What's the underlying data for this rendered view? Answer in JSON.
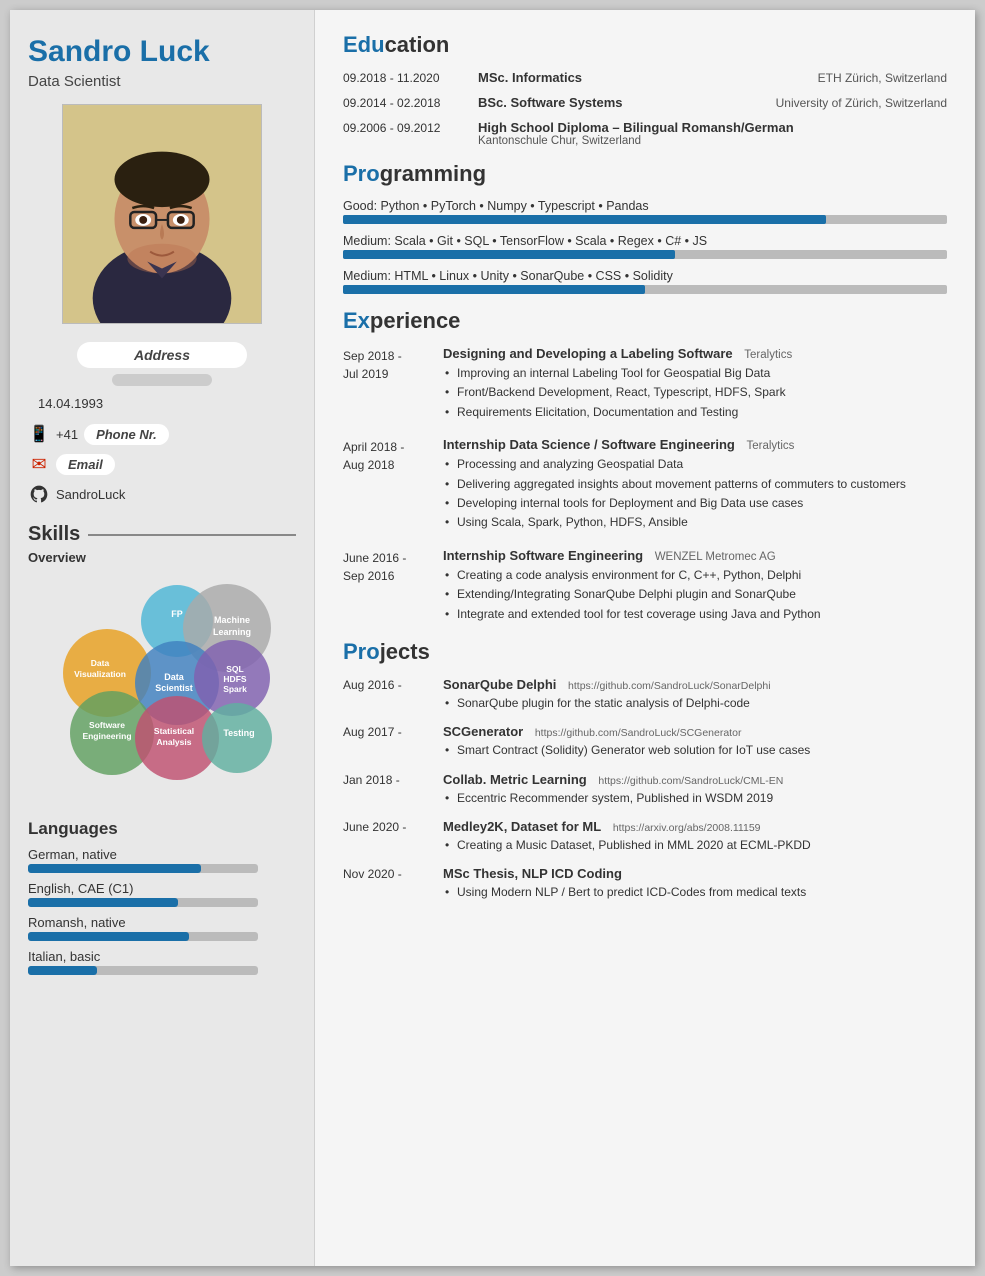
{
  "left": {
    "name": "Sandro Luck",
    "title": "Data Scientist",
    "address_label": "Address",
    "dob": "14.04.1993",
    "phone_prefix": "+41",
    "phone_label": "Phone Nr.",
    "email_label": "Email",
    "github": "SandroLuck",
    "skills_title": "Skills",
    "overview_label": "Overview",
    "venn_circles": [
      {
        "label": "FP",
        "class": "vc-fp"
      },
      {
        "label": "Machine\nLearning",
        "class": "vc-ml"
      },
      {
        "label": "Data\nVisualization",
        "class": "vc-dv"
      },
      {
        "label": "Data\nScientist",
        "class": "vc-ds"
      },
      {
        "label": "SQL\nHDFS\nSpark",
        "class": "vc-sql"
      },
      {
        "label": "Software\nEngineering",
        "class": "vc-se"
      },
      {
        "label": "Statistical\nAnalysis",
        "class": "vc-sa"
      },
      {
        "label": "Testing",
        "class": "vc-test"
      }
    ],
    "languages_title": "Languages",
    "languages": [
      {
        "name": "German, native",
        "fill_pct": 75
      },
      {
        "name": "English, CAE (C1)",
        "fill_pct": 65
      },
      {
        "name": "Romansh, native",
        "fill_pct": 70
      },
      {
        "name": "Italian, basic",
        "fill_pct": 30
      }
    ]
  },
  "right": {
    "education_title": "Education",
    "edu_highlight": "Edu",
    "education": [
      {
        "date": "09.2018 - 11.2020",
        "degree": "MSc. Informatics",
        "school_right": "ETH Zürich, Switzerland",
        "school": ""
      },
      {
        "date": "09.2014 - 02.2018",
        "degree": "BSc. Software Systems",
        "school_right": "University of Zürich, Switzerland",
        "school": ""
      },
      {
        "date": "09.2006 - 09.2012",
        "degree": "High School Diploma – Bilingual Romansh/German",
        "school_right": "",
        "school": "Kantonschule Chur, Switzerland"
      }
    ],
    "programming_title": "Programming",
    "prog_highlight": "Pro",
    "programming": [
      {
        "label": "Good:   Python  •  PyTorch  •  Numpy  •  Typescript  •  Pandas",
        "fill_pct": 80
      },
      {
        "label": "Medium: Scala  •  Git  •  SQL  •  TensorFlow  •  Scala  •  Regex  •  C#  •  JS",
        "fill_pct": 55
      },
      {
        "label": "Medium: HTML  •  Linux  •  Unity  •  SonarQube  •  CSS  •  Solidity",
        "fill_pct": 50
      }
    ],
    "experience_title": "Experience",
    "exp_highlight": "Ex",
    "experience": [
      {
        "date": "Sep 2018 -\nJul 2019",
        "title": "Designing and Developing a Labeling Software",
        "company": "Teralytics",
        "bullets": [
          "Improving an internal Labeling Tool for Geospatial Big Data",
          "Front/Backend Development, React, Typescript, HDFS, Spark",
          "Requirements Elicitation, Documentation and Testing"
        ]
      },
      {
        "date": "April 2018 -\nAug 2018",
        "title": "Internship Data Science / Software Engineering",
        "company": "Teralytics",
        "bullets": [
          "Processing and analyzing Geospatial Data",
          "Delivering aggregated insights about movement patterns of commuters to customers",
          "Developing internal tools for Deployment and Big Data use cases",
          "Using Scala, Spark, Python, HDFS, Ansible"
        ]
      },
      {
        "date": "June 2016 -\nSep 2016",
        "title": "Internship Software Engineering",
        "company": "WENZEL Metromec AG",
        "bullets": [
          "Creating a code analysis environment for C, C++, Python, Delphi",
          "Extending/Integrating SonarQube Delphi plugin and SonarQube",
          "Integrate and extended tool for test coverage using Java and Python"
        ]
      }
    ],
    "projects_title": "Projects",
    "proj_highlight": "Pro",
    "projects": [
      {
        "date": "Aug 2016 -",
        "title": "SonarQube Delphi",
        "url": "https://github.com/SandroLuck/SonarDelphi",
        "bullets": [
          "SonarQube plugin for the static analysis of Delphi-code"
        ]
      },
      {
        "date": "Aug 2017 -",
        "title": "SCGenerator",
        "url": "https://github.com/SandroLuck/SCGenerator",
        "bullets": [
          "Smart Contract (Solidity) Generator web solution for IoT use cases"
        ]
      },
      {
        "date": "Jan 2018 -",
        "title": "Collab. Metric Learning",
        "url": "https://github.com/SandroLuck/CML-EN",
        "bullets": [
          "Eccentric Recommender system, Published in WSDM 2019"
        ]
      },
      {
        "date": "June 2020 -",
        "title": "Medley2K, Dataset for ML",
        "url": "https://arxiv.org/abs/2008.11159",
        "bullets": [
          "Creating a Music Dataset, Published in MML 2020 at ECML-PKDD"
        ]
      },
      {
        "date": "Nov 2020 -",
        "title": "MSc Thesis, NLP ICD Coding",
        "url": "",
        "bullets": [
          "Using Modern NLP / Bert to predict ICD-Codes from medical texts"
        ]
      }
    ]
  }
}
